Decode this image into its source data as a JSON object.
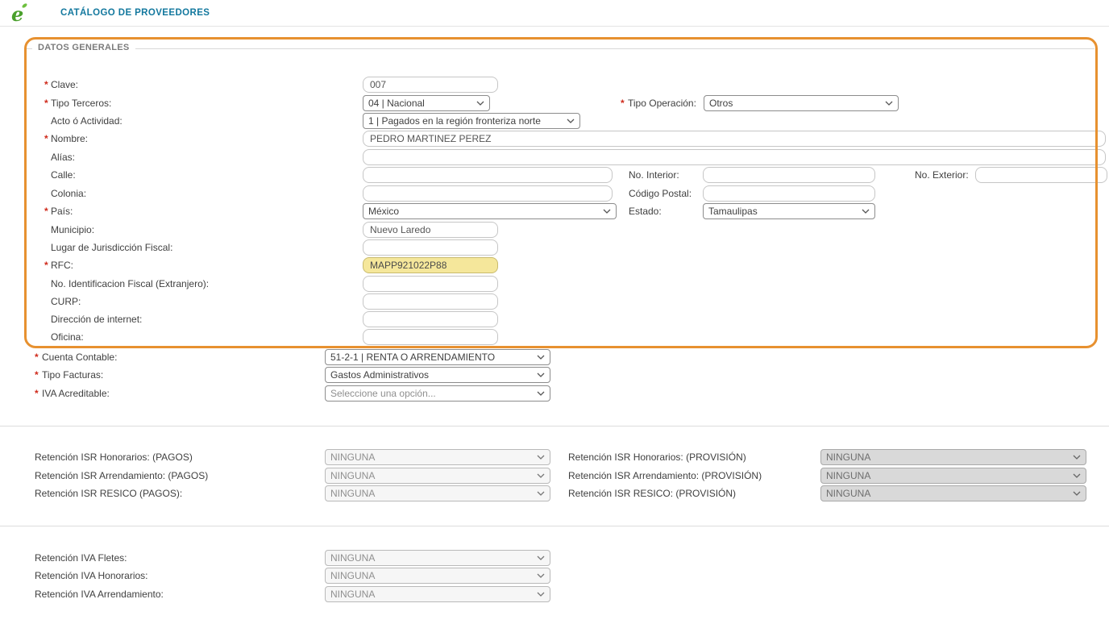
{
  "marks": {
    "required": "*"
  },
  "header": {
    "logo_text": "e",
    "title": "CATÁLOGO DE PROVEEDORES"
  },
  "section": {
    "legend": "DATOS GENERALES"
  },
  "fields": {
    "clave": {
      "label": "Clave:",
      "required": true,
      "value": "007"
    },
    "tipo_terceros": {
      "label": "Tipo Terceros:",
      "required": true,
      "value": "04 | Nacional"
    },
    "tipo_operacion": {
      "label": "Tipo Operación:",
      "required": true,
      "value": "Otros"
    },
    "acto_actividad": {
      "label": "Acto ó Actividad:",
      "value": "1 | Pagados en la región fronteriza norte"
    },
    "nombre": {
      "label": "Nombre:",
      "required": true,
      "value": "PEDRO MARTINEZ PEREZ"
    },
    "alias": {
      "label": "Alías:",
      "value": ""
    },
    "calle": {
      "label": "Calle:",
      "value": ""
    },
    "no_interior": {
      "label": "No. Interior:",
      "value": ""
    },
    "no_exterior": {
      "label": "No. Exterior:",
      "value": ""
    },
    "colonia": {
      "label": "Colonia:",
      "value": ""
    },
    "codigo_postal": {
      "label": "Código Postal:",
      "value": ""
    },
    "pais": {
      "label": "País:",
      "required": true,
      "value": "México"
    },
    "estado": {
      "label": "Estado:",
      "value": "Tamaulipas"
    },
    "municipio": {
      "label": "Municipio:",
      "value": "Nuevo Laredo"
    },
    "lugar_jurisdiccion": {
      "label": "Lugar de Jurisdicción Fiscal:",
      "value": ""
    },
    "rfc": {
      "label": "RFC:",
      "required": true,
      "value": "MAPP921022P88"
    },
    "no_id_fiscal": {
      "label": "No. Identificacion Fiscal (Extranjero):",
      "value": ""
    },
    "curp": {
      "label": "CURP:",
      "value": ""
    },
    "direccion_internet": {
      "label": "Dirección de internet:",
      "value": ""
    },
    "oficina": {
      "label": "Oficina:",
      "value": ""
    },
    "cuenta_contable": {
      "label": "Cuenta Contable:",
      "required": true,
      "value": "51-2-1 | RENTA O ARRENDAMIENTO"
    },
    "tipo_facturas": {
      "label": "Tipo Facturas:",
      "required": true,
      "value": "Gastos Administrativos"
    },
    "iva_acreditable": {
      "label": "IVA Acreditable:",
      "required": true,
      "value": "Seleccione una opción..."
    }
  },
  "retenciones_isr_pagos": [
    {
      "label": "Retención ISR Honorarios: (PAGOS)",
      "value": "NINGUNA"
    },
    {
      "label": "Retención ISR Arrendamiento: (PAGOS)",
      "value": "NINGUNA"
    },
    {
      "label": "Retención ISR RESICO (PAGOS):",
      "value": "NINGUNA"
    }
  ],
  "retenciones_isr_provision": [
    {
      "label": "Retención ISR Honorarios: (PROVISIÓN)",
      "value": "NINGUNA"
    },
    {
      "label": "Retención ISR Arrendamiento: (PROVISIÓN)",
      "value": "NINGUNA"
    },
    {
      "label": "Retención ISR RESICO: (PROVISIÓN)",
      "value": "NINGUNA"
    }
  ],
  "retenciones_iva": [
    {
      "label": "Retención IVA Fletes:",
      "value": "NINGUNA"
    },
    {
      "label": "Retención IVA Honorarios:",
      "value": "NINGUNA"
    },
    {
      "label": "Retención IVA Arrendamiento:",
      "value": "NINGUNA"
    }
  ],
  "colors": {
    "accent_orange": "#e79130",
    "title_teal": "#13789e",
    "required_red": "#cf2a1b",
    "rfc_highlight": "#f5e79b"
  }
}
